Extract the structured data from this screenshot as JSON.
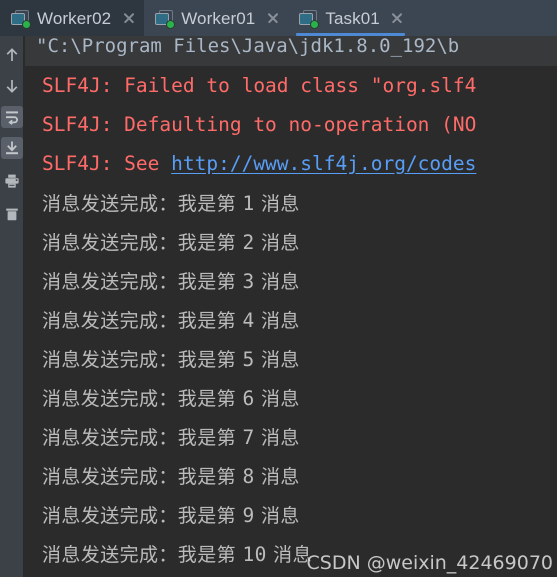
{
  "window": {
    "background_color": "#2b2b2b",
    "tabbar_color": "#3c4552"
  },
  "tabbar": {
    "tabs": [
      {
        "label": "Worker02",
        "icon": "run-configuration-icon",
        "state": "inactive-highlighted",
        "close_icon": "close-icon"
      },
      {
        "label": "Worker01",
        "icon": "run-configuration-icon",
        "state": "inactive",
        "close_icon": "close-icon"
      },
      {
        "label": "Task01",
        "icon": "run-configuration-icon",
        "state": "active",
        "close_icon": "close-icon"
      }
    ],
    "active_tab_index": 2,
    "active_underline_color": "#4e8ad4"
  },
  "left_toolbar": {
    "buttons": [
      {
        "name": "up-arrow-icon",
        "tooltip": "Up the stack trace",
        "active": false
      },
      {
        "name": "down-arrow-icon",
        "tooltip": "Down the stack trace",
        "active": false
      },
      {
        "name": "soft-wrap-icon",
        "tooltip": "Use Soft Wraps",
        "active": true
      },
      {
        "name": "scroll-to-end-icon",
        "tooltip": "Scroll to the end",
        "active": true
      },
      {
        "name": "print-icon",
        "tooltip": "Print",
        "active": false
      },
      {
        "name": "trash-icon",
        "tooltip": "Clear All",
        "active": false
      }
    ]
  },
  "console": {
    "lines": [
      {
        "type": "command",
        "text": "\"C:\\Program Files\\Java\\jdk1.8.0_192\\b"
      },
      {
        "type": "error",
        "text": "SLF4J: Failed to load class \"org.slf4"
      },
      {
        "type": "error",
        "text": "SLF4J: Defaulting to no-operation (NO"
      },
      {
        "type": "error",
        "prefix": "SLF4J: See ",
        "link": "http://www.slf4j.org/codes"
      },
      {
        "type": "message",
        "prefix": "消息发送完成：我是第 ",
        "number": "1",
        "suffix": " 消息"
      },
      {
        "type": "message",
        "prefix": "消息发送完成：我是第 ",
        "number": "2",
        "suffix": " 消息"
      },
      {
        "type": "message",
        "prefix": "消息发送完成：我是第 ",
        "number": "3",
        "suffix": " 消息"
      },
      {
        "type": "message",
        "prefix": "消息发送完成：我是第 ",
        "number": "4",
        "suffix": " 消息"
      },
      {
        "type": "message",
        "prefix": "消息发送完成：我是第 ",
        "number": "5",
        "suffix": " 消息"
      },
      {
        "type": "message",
        "prefix": "消息发送完成：我是第 ",
        "number": "6",
        "suffix": " 消息"
      },
      {
        "type": "message",
        "prefix": "消息发送完成：我是第 ",
        "number": "7",
        "suffix": " 消息"
      },
      {
        "type": "message",
        "prefix": "消息发送完成：我是第 ",
        "number": "8",
        "suffix": " 消息"
      },
      {
        "type": "message",
        "prefix": "消息发送完成：我是第 ",
        "number": "9",
        "suffix": " 消息"
      },
      {
        "type": "message",
        "prefix": "消息发送完成：我是第 ",
        "number": "10",
        "suffix": " 消息"
      }
    ],
    "colors": {
      "error_text": "#ff6b68",
      "link_text": "#589df6",
      "message_text": "#bbbbbb",
      "command_text": "#a9b7c6",
      "command_background": "#37393b"
    }
  },
  "watermark": {
    "text": "CSDN @weixin_42469070"
  }
}
